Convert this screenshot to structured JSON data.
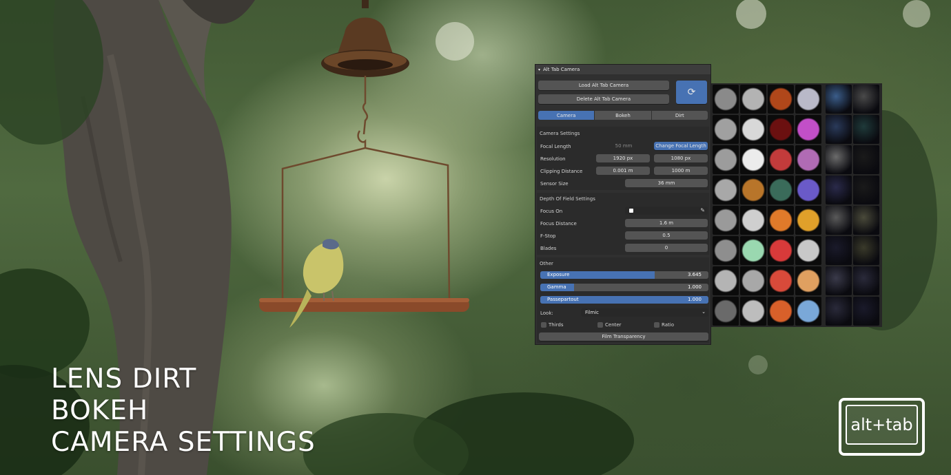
{
  "headline": {
    "line1": "LENS DIRT",
    "line2": "BOKEH",
    "line3": "CAMERA SETTINGS"
  },
  "logo": {
    "text": "alt+tab"
  },
  "panel": {
    "title": "Alt Tab Camera",
    "load_button": "Load Alt Tab Camera",
    "delete_button": "Delete Alt Tab Camera",
    "refresh_icon": "refresh-icon",
    "tabs": [
      "Camera",
      "Bokeh",
      "Dirt"
    ],
    "active_tab": "Camera",
    "camera_settings": {
      "title": "Camera Settings",
      "focal_length_label": "Focal Length",
      "focal_length_value": "50 mm",
      "change_focal_button": "Change Focal Length",
      "resolution_label": "Resolution",
      "resolution_x": "1920 px",
      "resolution_y": "1080 px",
      "clipping_label": "Clipping Distance",
      "clip_start": "0.001 m",
      "clip_end": "1000 m",
      "sensor_label": "Sensor Size",
      "sensor_value": "36 mm"
    },
    "dof_settings": {
      "title": "Depth Of Field Settings",
      "focus_on_label": "Focus On",
      "focus_distance_label": "Focus Distance",
      "focus_distance_value": "1.6 m",
      "fstop_label": "F-Stop",
      "fstop_value": "0.5",
      "blades_label": "Blades",
      "blades_value": "0"
    },
    "other": {
      "title": "Other",
      "exposure_label": "Exposure",
      "exposure_value": "3.645",
      "exposure_fill": 0.68,
      "gamma_label": "Gamma",
      "gamma_value": "1.000",
      "gamma_fill": 0.2,
      "passepartout_label": "Passepartout",
      "passepartout_value": "1.000",
      "passepartout_fill": 1.0,
      "look_label": "Look:",
      "look_value": "Filmic",
      "thirds_label": "Thirds",
      "center_label": "Center",
      "ratio_label": "Ratio",
      "film_transparency_button": "Film Transparency"
    }
  },
  "thumbnails": {
    "colors": [
      [
        "#8a8a8a",
        "#b3b3b3",
        "#b0471a",
        "#b9b9c8",
        "#3b5d8a",
        "#4a4a4a"
      ],
      [
        "#a0a0a0",
        "#d8d8d8",
        "#6b1010",
        "#c24fc8",
        "#2a3a5a",
        "#1f3a3a"
      ],
      [
        "#9c9c9c",
        "#ececec",
        "#c23b3b",
        "#b06bb4",
        "#6b6b6b",
        "#1a1a1a"
      ],
      [
        "#a8a8a8",
        "#b8752a",
        "#3a6b5a",
        "#6a5ac8",
        "#2a2a4a",
        "#1a1a1a"
      ],
      [
        "#9a9a9a",
        "#cfcfcf",
        "#e07a2a",
        "#e0a02a",
        "#5a5a5a",
        "#4a4a3a"
      ],
      [
        "#8e8e8e",
        "#9ad8b0",
        "#d83a3a",
        "#c8c8c8",
        "#1a1a2a",
        "#3a3a2a"
      ],
      [
        "#b4b4b4",
        "#a8a8a8",
        "#d84a3a",
        "#e0a060",
        "#3a3a4a",
        "#2a2a3a"
      ],
      [
        "#6a6a6a",
        "#bdbdbd",
        "#d8602a",
        "#7aa8d8",
        "#2a2a3a",
        "#1a1a2a"
      ]
    ]
  }
}
